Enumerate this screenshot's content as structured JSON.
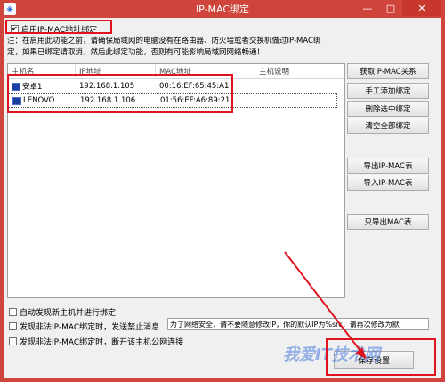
{
  "window": {
    "title": "IP-MAC绑定",
    "minimize": "—",
    "maximize": "□",
    "close": "✕",
    "icon": "network-app-icon"
  },
  "enable_binding": {
    "label": "启用IP-MAC地址绑定",
    "checked": true
  },
  "note": {
    "line1": "注：在启用此功能之前，请确保局域网的电脑没有在路由器、防火墙或者交换机做过IP-MAC绑",
    "line2": "定，如果已绑定请取消，然后此绑定功能，否则有可能影响局域网网络畅通！"
  },
  "table": {
    "columns": [
      "主机名",
      "IP地址",
      "MAC地址",
      "主机说明"
    ],
    "rows": [
      {
        "host": "安卓1",
        "ip": "192.168.1.105",
        "mac": "00:16:EF:65:45:A1",
        "desc": ""
      },
      {
        "host": "LENOVO",
        "ip": "192.168.1.106",
        "mac": "01:56:EF:A6:89:21",
        "desc": ""
      }
    ]
  },
  "buttons": {
    "get_ipmac": "获取IP-MAC关系",
    "manual_add": "手工添加绑定",
    "delete_selected": "删除选中绑定",
    "clear_all": "清空全部绑定",
    "export": "导出IP-MAC表",
    "import": "导入IP-MAC表",
    "export_mac_only": "只导出MAC表",
    "save": "保存设置"
  },
  "options": {
    "auto_discover": {
      "label": "自动发现新主机并进行绑定",
      "checked": false
    },
    "notify_illegal": {
      "label": "发现非法IP-MAC绑定时，发送禁止消息",
      "checked": false
    },
    "notify_message": "为了网络安全，请不要随意修改IP，你的默认IP为%src，请再次修改为默",
    "disconnect_illegal": {
      "label": "发现非法IP-MAC绑定时，断开该主机公网连接",
      "checked": false
    }
  },
  "watermark": "我爱IT技术网"
}
